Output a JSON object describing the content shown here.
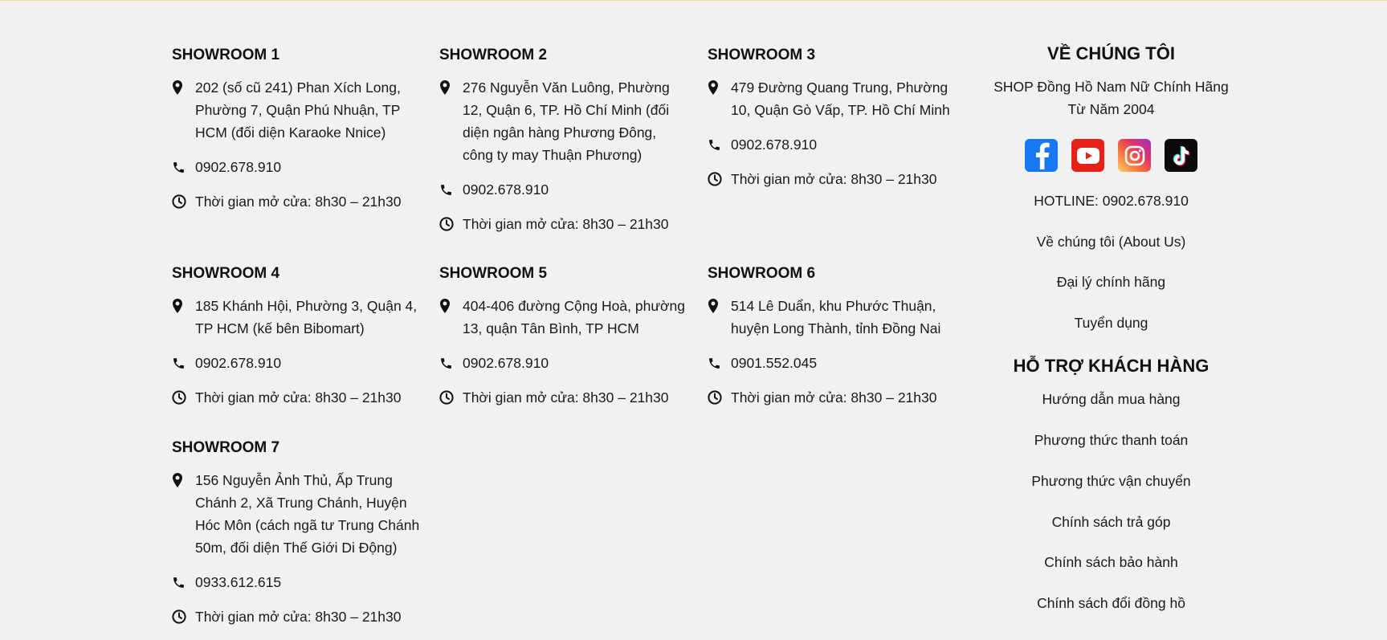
{
  "showrooms": [
    {
      "title": "SHOWROOM 1",
      "address": "202 (số cũ 241) Phan Xích Long, Phường 7, Quận Phú Nhuận, TP HCM (đối diện Karaoke Nnice)",
      "phone": "0902.678.910",
      "hours": "Thời gian mở cửa: 8h30 – 21h30"
    },
    {
      "title": "SHOWROOM 2",
      "address": "276 Nguyễn Văn Luông, Phường 12, Quận 6, TP. Hồ Chí Minh (đối diện ngân hàng Phương Đông, công ty may Thuận Phương)",
      "phone": "0902.678.910",
      "hours": "Thời gian mở cửa: 8h30 – 21h30"
    },
    {
      "title": "SHOWROOM 3",
      "address": "479 Đường Quang Trung, Phường 10, Quận Gò Vấp, TP. Hồ Chí Minh",
      "phone": "0902.678.910",
      "hours": "Thời gian mở cửa: 8h30 – 21h30"
    },
    {
      "title": "SHOWROOM 4",
      "address": "185 Khánh Hội, Phường 3, Quận 4, TP HCM (kế bên Bibomart)",
      "phone": "0902.678.910",
      "hours": "Thời gian mở cửa: 8h30 – 21h30"
    },
    {
      "title": "SHOWROOM 5",
      "address": "404-406 đường Cộng Hoà, phường 13, quận Tân Bình, TP HCM",
      "phone": "0902.678.910",
      "hours": "Thời gian mở cửa: 8h30 – 21h30"
    },
    {
      "title": "SHOWROOM 6",
      "address": "514 Lê Duẩn, khu Phước Thuận, huyện Long Thành, tỉnh Đồng Nai",
      "phone": "0901.552.045",
      "hours": "Thời gian mở cửa: 8h30 – 21h30"
    },
    {
      "title": "SHOWROOM 7",
      "address": "156 Nguyễn Ảnh Thủ, Ấp Trung Chánh 2, Xã Trung Chánh, Huyện Hóc Môn (cách ngã tư Trung Chánh 50m, đối diện Thế Giới Di Động)",
      "phone": "0933.612.615",
      "hours": "Thời gian mở cửa: 8h30 – 21h30"
    }
  ],
  "about": {
    "title": "VỀ CHÚNG TÔI",
    "tagline": "SHOP Đồng Hồ Nam Nữ Chính Hãng Từ Năm 2004",
    "hotline": "HOTLINE: 0902.678.910",
    "links": [
      "Về chúng tôi (About Us)",
      "Đại lý chính hãng",
      "Tuyển dụng"
    ]
  },
  "social": [
    "facebook-icon",
    "youtube-icon",
    "instagram-icon",
    "tiktok-icon"
  ],
  "support": {
    "title": "HỖ TRỢ KHÁCH HÀNG",
    "links": [
      "Hướng dẫn mua hàng",
      "Phương thức thanh toán",
      "Phương thức vận chuyển",
      "Chính sách trả góp",
      "Chính sách bảo hành",
      "Chính sách đổi đồng hồ"
    ]
  },
  "colors": {
    "background": "#f1f1f1",
    "text": "#111111",
    "facebook": "#1877f2",
    "youtube": "#e62117",
    "tiktok": "#0a0a0a"
  }
}
